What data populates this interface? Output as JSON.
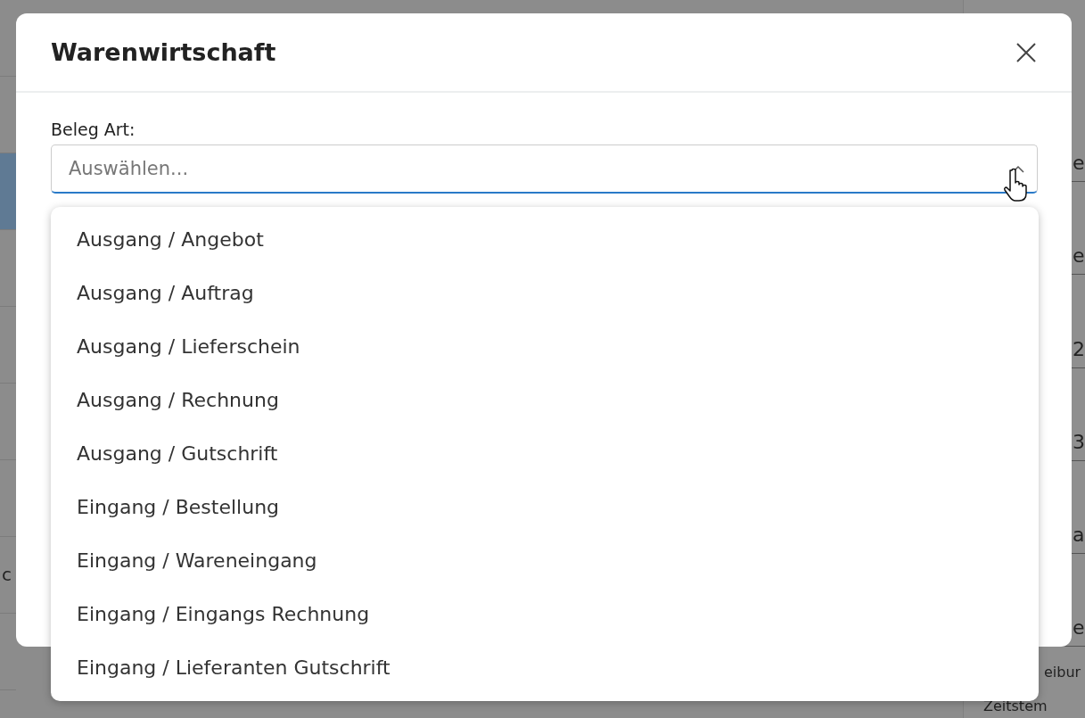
{
  "background": {
    "left_texts": [
      "c"
    ],
    "right_upper_texts": [
      "e",
      "e",
      "2",
      "3",
      "a",
      "e"
    ],
    "right_lower_texts": [
      "eibur",
      "Zeitstem"
    ]
  },
  "dialog": {
    "title": "Warenwirtschaft",
    "field": {
      "label": "Beleg Art:",
      "placeholder": "Auswählen...",
      "expanded": true
    },
    "options": [
      {
        "label": "Ausgang / Angebot",
        "selected": false
      },
      {
        "label": "Ausgang / Auftrag",
        "selected": false
      },
      {
        "label": "Ausgang / Lieferschein",
        "selected": false
      },
      {
        "label": "Ausgang / Rechnung",
        "selected": false
      },
      {
        "label": "Ausgang / Gutschrift",
        "selected": false
      },
      {
        "label": "Eingang / Bestellung",
        "selected": false
      },
      {
        "label": "Eingang / Wareneingang",
        "selected": false
      },
      {
        "label": "Eingang / Eingangs Rechnung",
        "selected": false
      },
      {
        "label": "Eingang / Lieferanten Gutschrift",
        "selected": false
      }
    ]
  }
}
